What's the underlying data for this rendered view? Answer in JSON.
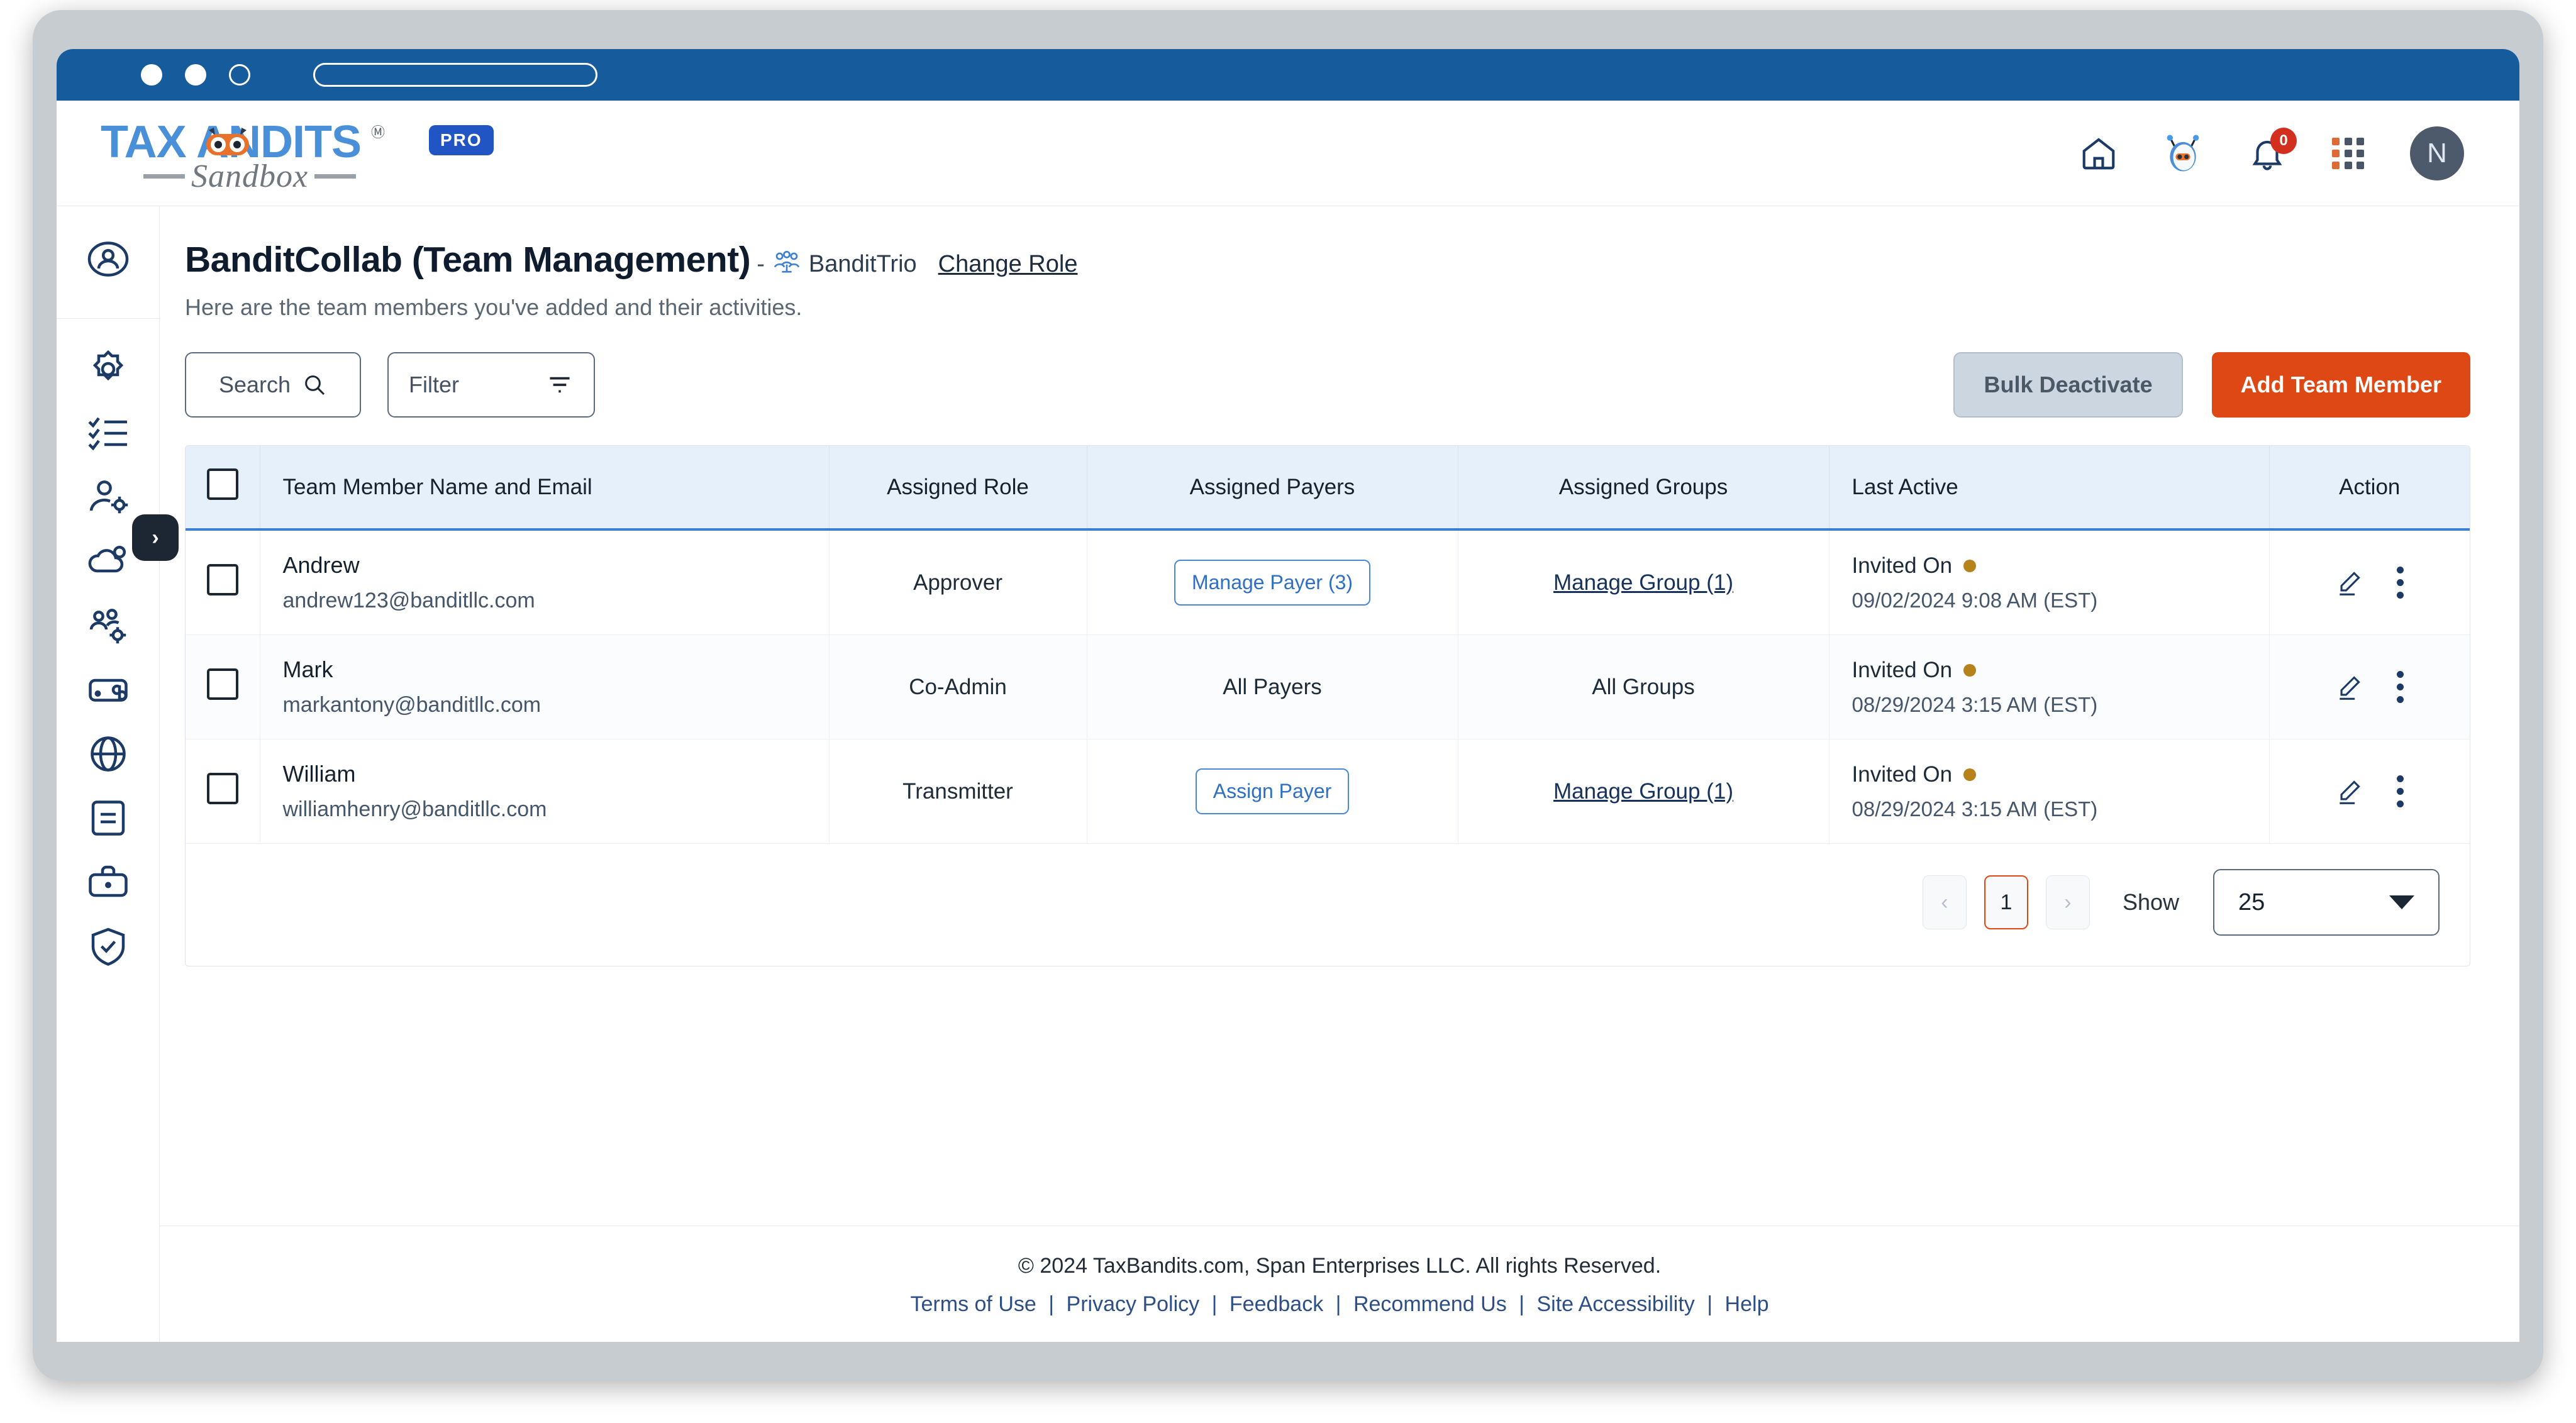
{
  "browser": {
    "dots": [
      "window-dot-1",
      "window-dot-2",
      "window-dot-3"
    ],
    "url_value": ""
  },
  "brand": {
    "logo_main": "TAX   ANDITS",
    "logo_tm": "Ⓜ",
    "logo_sub": "Sandbox",
    "badge": "PRO"
  },
  "header": {
    "icons": [
      "home-icon",
      "bot-icon",
      "bell-icon",
      "apps-grid-icon"
    ],
    "notification_count": "0",
    "avatar_initial": "N"
  },
  "sidebar": {
    "items": [
      {
        "name": "profile-icon"
      },
      {
        "name": "settings-gear-icon"
      },
      {
        "name": "checklist-icon"
      },
      {
        "name": "user-settings-icon"
      },
      {
        "name": "cloud-user-icon"
      },
      {
        "name": "team-settings-icon"
      },
      {
        "name": "wallet-dollar-icon"
      },
      {
        "name": "globe-icon"
      },
      {
        "name": "document-icon"
      },
      {
        "name": "briefcase-icon"
      },
      {
        "name": "shield-check-icon"
      }
    ],
    "expand_label": "›"
  },
  "page": {
    "title": "BanditCollab (Team Management)",
    "dash": "-",
    "org_name": "BanditTrio",
    "change_role": "Change Role",
    "subtitle": "Here are the team members you've added and their activities."
  },
  "toolbar": {
    "search_label": "Search",
    "filter_label": "Filter",
    "bulk_deactivate_label": "Bulk Deactivate",
    "add_team_member_label": "Add Team Member"
  },
  "table": {
    "columns": [
      "Team Member Name and Email",
      "Assigned Role",
      "Assigned Payers",
      "Assigned Groups",
      "Last Active",
      "Action"
    ],
    "rows": [
      {
        "name": "Andrew",
        "email": "andrew123@banditllc.com",
        "role": "Approver",
        "payers_label": "Manage Payer (3)",
        "payers_type": "button",
        "groups_label": "Manage Group (1)",
        "groups_type": "link",
        "last_active_label": "Invited On",
        "last_active_stamp": "09/02/2024 9:08 AM (EST)"
      },
      {
        "name": "Mark",
        "email": "markantony@banditllc.com",
        "role": "Co-Admin",
        "payers_label": "All Payers",
        "payers_type": "text",
        "groups_label": "All Groups",
        "groups_type": "text",
        "last_active_label": "Invited On",
        "last_active_stamp": "08/29/2024 3:15 AM (EST)"
      },
      {
        "name": "William",
        "email": "williamhenry@banditllc.com",
        "role": "Transmitter",
        "payers_label": "Assign Payer",
        "payers_type": "button",
        "groups_label": "Manage Group (1)",
        "groups_type": "link",
        "last_active_label": "Invited On",
        "last_active_stamp": "08/29/2024 3:15 AM (EST)"
      }
    ]
  },
  "pagination": {
    "prev": "‹",
    "page": "1",
    "next": "›",
    "show_label": "Show",
    "page_size": "25"
  },
  "footer": {
    "copyright": "© 2024 TaxBandits.com, Span Enterprises LLC. All rights Reserved.",
    "links": [
      "Terms of Use",
      "Privacy Policy",
      "Feedback",
      "Recommend Us",
      "Site Accessibility",
      "Help"
    ],
    "separator": "|"
  },
  "colors": {
    "titlebar_blue": "#165c9c",
    "primary_orange": "#dd4814",
    "table_header_blue": "#e6f0fb",
    "accent_blue": "#3d7fd1",
    "status_dot": "#b5821b"
  }
}
